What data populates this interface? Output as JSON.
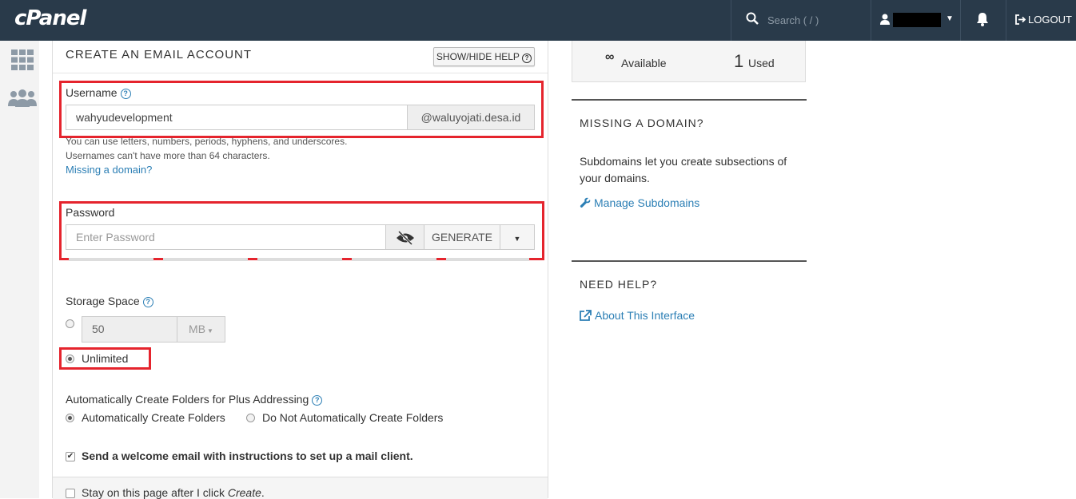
{
  "header": {
    "logo": "cPanel",
    "search_placeholder": "Search ( / )",
    "logout_label": "LOGOUT"
  },
  "form": {
    "title": "CREATE AN EMAIL ACCOUNT",
    "help_toggle": "SHOW/HIDE HELP",
    "username": {
      "label": "Username",
      "value": "wahyudevelopment",
      "domain": "@waluyojati.desa.id",
      "hint_line1": "You can use letters, numbers, periods, hyphens, and underscores.",
      "hint_line2": "Usernames can't have more than 64 characters.",
      "missing_domain_link": "Missing a domain?"
    },
    "password": {
      "label": "Password",
      "placeholder": "Enter Password",
      "generate_label": "GENERATE"
    },
    "storage": {
      "label": "Storage Space",
      "value": "50",
      "unit": "MB",
      "unlimited_label": "Unlimited",
      "selected": "unlimited"
    },
    "plus_addressing": {
      "label": "Automatically Create Folders for Plus Addressing",
      "option_auto": "Automatically Create Folders",
      "option_no_auto": "Do Not Automatically Create Folders",
      "selected": "auto"
    },
    "welcome_email": {
      "label": "Send a welcome email with instructions to set up a mail client.",
      "checked": true
    },
    "stay_on_page": {
      "label_prefix": "Stay on this page after I click ",
      "label_em": "Create",
      "label_suffix": ".",
      "checked": false
    }
  },
  "sidebar": {
    "stats": {
      "available_label": "Available",
      "used_count": "1",
      "used_label": "Used"
    },
    "missing_domain": {
      "heading": "MISSING A DOMAIN?",
      "text": "Subdomains let you create subsections of your domains.",
      "link": "Manage Subdomains"
    },
    "need_help": {
      "heading": "NEED HELP?",
      "link": "About This Interface"
    }
  },
  "colors": {
    "topbar": "#293a4a",
    "link": "#2c7fb5",
    "highlight": "#e5242d"
  }
}
